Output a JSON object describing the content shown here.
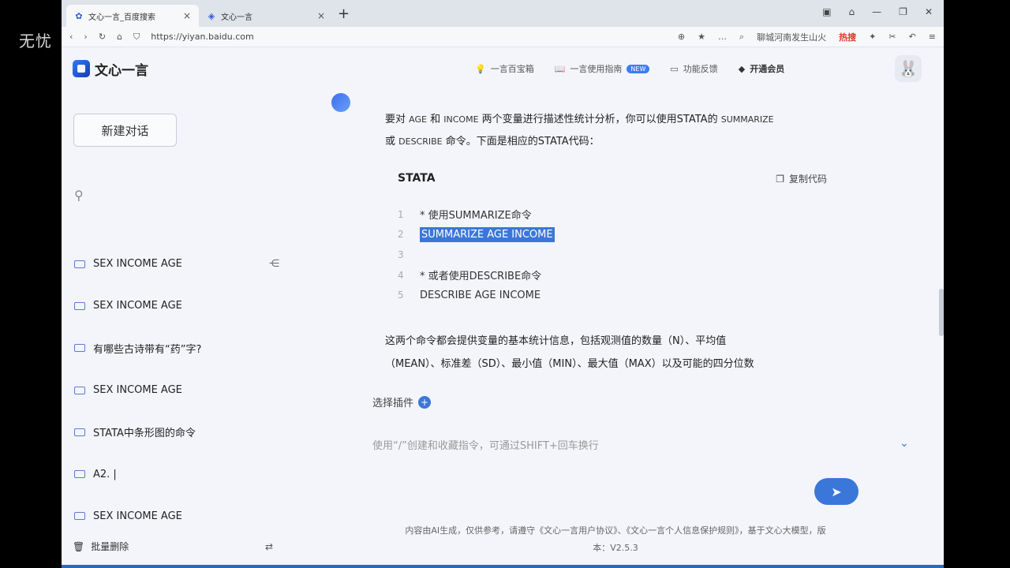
{
  "watermark": "无忧",
  "browser": {
    "tabs": [
      {
        "label": "文心一言_百度搜索",
        "active": true
      },
      {
        "label": "文心一言",
        "active": false
      }
    ],
    "new_tab": "+",
    "url": "https://yiyan.baidu.com",
    "hot_search": "聊城河南发生山火",
    "hot_badge": "热搜"
  },
  "header": {
    "logo_text": "文心一言",
    "nav": [
      {
        "label": "一言百宝箱",
        "icon": "bulb-icon"
      },
      {
        "label": "一言使用指南",
        "icon": "book-icon",
        "badge": "NEW"
      },
      {
        "label": "功能反馈",
        "icon": "feedback-icon"
      },
      {
        "label": "开通会员",
        "icon": "diamond-icon"
      }
    ]
  },
  "sidebar": {
    "new_chat": "新建对话",
    "history": [
      "SEX INCOME AGE",
      "SEX INCOME AGE",
      "有哪些古诗带有“药”字?",
      "SEX INCOME AGE",
      "STATA中条形图的命令",
      "A2. |",
      "SEX INCOME AGE"
    ],
    "bulk_delete": "批量删除"
  },
  "chat": {
    "intro_line1_a": "要对",
    "intro_age": "AGE",
    "intro_and": "和",
    "intro_income": "INCOME",
    "intro_line1_b": "两个变量进行描述性统计分析，你可以使用STATA的",
    "intro_summarize": "SUMMARIZE",
    "intro_or": "或",
    "intro_describe": "DESCRIBE",
    "intro_line2": "命令。下面是相应的STATA代码：",
    "code_lang": "STATA",
    "copy_label": "复制代码",
    "code_lines": [
      {
        "num": "1",
        "text": "* 使用SUMMARIZE命令"
      },
      {
        "num": "2",
        "text": "SUMMARIZE AGE INCOME"
      },
      {
        "num": "3",
        "text": ""
      },
      {
        "num": "4",
        "text": "* 或者使用DESCRIBE命令"
      },
      {
        "num": "5",
        "text": "DESCRIBE AGE INCOME"
      }
    ],
    "summary_line1": "这两个命令都会提供变量的基本统计信息，包括观测值的数量（N）、平均值",
    "summary_line2": "（MEAN）、标准差（SD）、最小值（MIN）、最大值（MAX）以及可能的四分位数"
  },
  "composer": {
    "plugins_label": "选择插件",
    "placeholder": "使用“/”创建和收藏指令，可通过SHIFT+回车换行"
  },
  "footer_note_line1": "内容由AI生成，仅供参考，请遵守《文心一言用户协议》、《文心一言个人信息保护规则》，基于文心大模型，版",
  "footer_note_line2": "本：V2.5.3"
}
